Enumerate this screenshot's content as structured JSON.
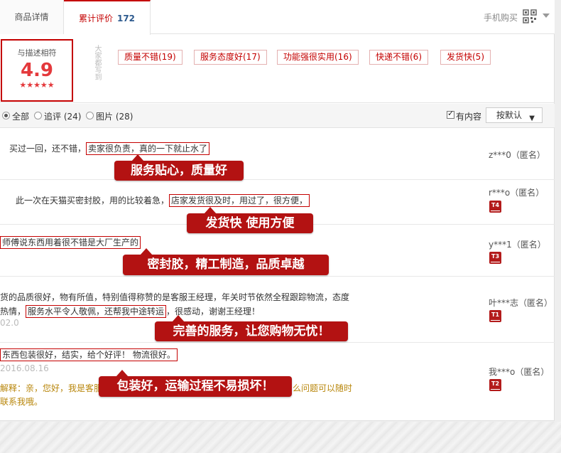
{
  "tabs": {
    "detail": "商品详情",
    "reviews": "累计评价",
    "review_count": "172",
    "mobile_buy": "手机购买"
  },
  "rating": {
    "label": "与描述相符",
    "score": "4.9",
    "stars": "★★★★★",
    "vertical_label": "大家都写到"
  },
  "tags": [
    "质量不错(19)",
    "服务态度好(17)",
    "功能强很实用(16)",
    "快递不错(6)",
    "发货快(5)"
  ],
  "filters": {
    "all": "全部",
    "append": "追评 (24)",
    "images": "图片 (28)",
    "has_content": "有内容",
    "sort": "按默认"
  },
  "reviews": [
    {
      "text_before": "买过一回，还不错，",
      "highlight": "卖家很负责，真的一下就止水了",
      "text_after": "",
      "user": "z***0（匿名）",
      "badge": "",
      "callout": "服务贴心，质量好"
    },
    {
      "text_before": "此一次在天猫买密封胶，用的比较着急，",
      "highlight": "店家发货很及时，用过了，很方便，",
      "text_after": "",
      "user": "r***o（匿名）",
      "badge": "T4",
      "callout": "发货快  使用方便"
    },
    {
      "text_before": "",
      "highlight": "师傅说东西用着很不错是大厂生产的",
      "text_after": "",
      "user": "y***1（匿名）",
      "badge": "T3",
      "callout": "密封胶，精工制造，品质卓越"
    },
    {
      "line1": "货的品质很好，物有所值，特别值得称赞的是客服王经理，年关时节依然全程跟踪物流，态度",
      "text_before": "热情，",
      "highlight": "服务水平令人敬佩，还帮我中途转运",
      "text_after": "，很感动，谢谢王经理！",
      "date": "02.0",
      "user": "叶***志（匿名）",
      "badge": "T1",
      "callout": "完善的服务，让您购物无忧！"
    },
    {
      "text_before": "",
      "highlight": "东西包装很好，结实，给个好评！ 物流很好。",
      "text_after": "",
      "date": "2016.08.16",
      "reply_start": "解释：亲，您好，我是客服",
      "reply_end": "么问题可以随时",
      "reply_line2": "联系我哦。",
      "user": "我***o（匿名）",
      "badge": "T2",
      "callout": "包装好，运输过程不易损坏！"
    }
  ],
  "colors": {
    "accent": "#c40000",
    "callout": "#b31212",
    "count": "#2d5a8e",
    "reply": "#b8860b"
  }
}
